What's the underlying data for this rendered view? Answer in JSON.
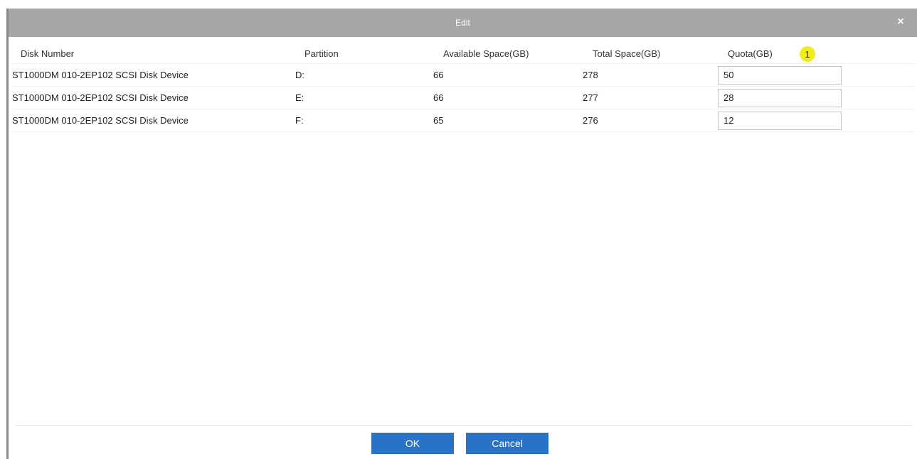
{
  "dialog": {
    "title": "Edit",
    "close_label": "×"
  },
  "table": {
    "headers": {
      "disk_number": "Disk Number",
      "partition": "Partition",
      "available": "Available Space(GB)",
      "total": "Total Space(GB)",
      "quota": "Quota(GB)"
    },
    "badge": "1",
    "rows": [
      {
        "disk": "ST1000DM 010-2EP102 SCSI Disk Device",
        "partition": "D:",
        "available": "66",
        "total": "278",
        "quota": "50"
      },
      {
        "disk": "ST1000DM 010-2EP102 SCSI Disk Device",
        "partition": "E:",
        "available": "66",
        "total": "277",
        "quota": "28"
      },
      {
        "disk": "ST1000DM 010-2EP102 SCSI Disk Device",
        "partition": "F:",
        "available": "65",
        "total": "276",
        "quota": "12"
      }
    ]
  },
  "buttons": {
    "ok": "OK",
    "cancel": "Cancel"
  },
  "colors": {
    "title_bar": "#a7a7a7",
    "primary_button": "#2873c7",
    "badge": "#f2ec1f"
  }
}
